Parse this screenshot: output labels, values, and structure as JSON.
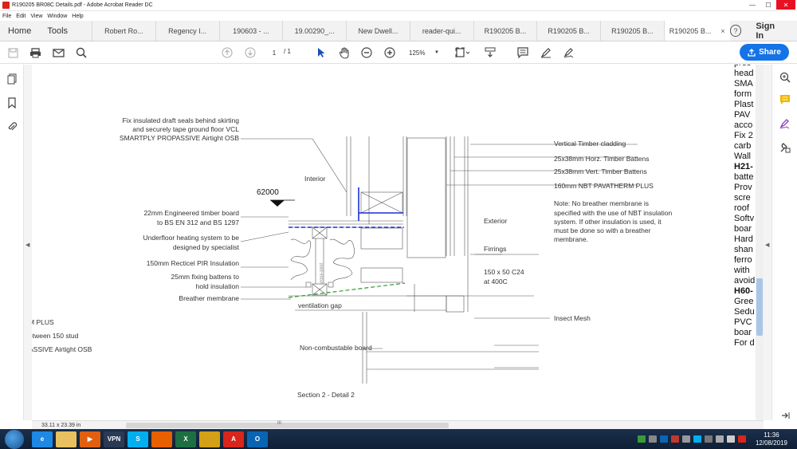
{
  "window": {
    "title": "R190205 BR08C Details.pdf - Adobe Acrobat Reader DC",
    "controls": {
      "minimize": "—",
      "maximize": "☐",
      "close": "✕"
    }
  },
  "menu": [
    "File",
    "Edit",
    "View",
    "Window",
    "Help"
  ],
  "tabs": {
    "home": "Home",
    "tools": "Tools",
    "documents": [
      "Robert Ro...",
      "Regency I...",
      "190603 - ...",
      "19.00290_...",
      "New Dwell...",
      "reader-qui...",
      "R190205 B...",
      "R190205 B...",
      "R190205 B..."
    ],
    "active_document": "R190205 B...",
    "close_glyph": "×"
  },
  "header_right": {
    "help": "?",
    "sign_in": "Sign In"
  },
  "toolbar": {
    "page_current": "1",
    "page_total": "/ 1",
    "zoom": "125%",
    "share_label": "Share"
  },
  "drawing": {
    "labels_left": [
      "Fix insulated draft seals behind skirting",
      "and securely tape ground floor VCL",
      "SMARTPLY PROPASSIVE Airtight OSB",
      "22mm Engineered timber board",
      "to BS EN 312 and BS 1297",
      "Underfloor heating system to be",
      "designed by specialist",
      "150mm Recticel PIR Insulation",
      "25mm fixing battens to",
      "hold insulation",
      "Breather membrane"
    ],
    "labels_right": [
      "Vertical Timber cladding",
      "25x38mm Horz. Timber Battens",
      "25x38mm Vert. Timber Battens",
      "160mm NBT PAVATHERM PLUS"
    ],
    "note": [
      "Note: No breather membrane is",
      "specified with the use of NBT insulation",
      "system. If other insulation is used, it",
      "must be done so with a breather",
      "membrane."
    ],
    "interior": "Interior",
    "exterior": "Exterior",
    "firrings": "Firrings",
    "timber": [
      "150 x 50 C24",
      "at 400C"
    ],
    "level": "62000",
    "ventilation": "ventilation gap",
    "noncombustible": "Non-combustable board",
    "insect_mesh": "Insect Mesh",
    "cross_joist": "cross-joist",
    "section_title": "Section 2 - Detail 2",
    "partial_left": [
      "M PLUS",
      "etween 150 stud",
      "ASSIVE Airtight OSB"
    ]
  },
  "right_text": [
    {
      "t": "pres",
      "b": false
    },
    {
      "t": "head",
      "b": false
    },
    {
      "t": "SMA",
      "b": false
    },
    {
      "t": "form",
      "b": false
    },
    {
      "t": "Plast",
      "b": false
    },
    {
      "t": "PAV",
      "b": false
    },
    {
      "t": "acco",
      "b": false
    },
    {
      "t": "Fix 2",
      "b": false
    },
    {
      "t": "carb",
      "b": false
    },
    {
      "t": "",
      "b": false
    },
    {
      "t": "Wall",
      "b": false
    },
    {
      "t": "",
      "b": false
    },
    {
      "t": "",
      "b": false
    },
    {
      "t": "H21-",
      "b": true
    },
    {
      "t": "batte",
      "b": false
    },
    {
      "t": "",
      "b": false
    },
    {
      "t": "Prov",
      "b": false
    },
    {
      "t": "scre",
      "b": false
    },
    {
      "t": "roof",
      "b": false
    },
    {
      "t": "Softv",
      "b": false
    },
    {
      "t": "boar",
      "b": false
    },
    {
      "t": "Hard",
      "b": false
    },
    {
      "t": "shan",
      "b": false
    },
    {
      "t": "ferro",
      "b": false
    },
    {
      "t": "with",
      "b": false
    },
    {
      "t": "avoid",
      "b": false
    },
    {
      "t": "",
      "b": false
    },
    {
      "t": "H60-",
      "b": true
    },
    {
      "t": "Gree",
      "b": false
    },
    {
      "t": "Sedu",
      "b": false
    },
    {
      "t": "PVC",
      "b": false
    },
    {
      "t": "boar",
      "b": false
    },
    {
      "t": "For d",
      "b": false
    }
  ],
  "status": {
    "dimensions": "33.11 x 23.39 in",
    "scroll_grip": "III"
  },
  "taskbar": {
    "apps": [
      {
        "name": "ie",
        "label": "e",
        "color": "#1e88e5"
      },
      {
        "name": "explorer",
        "label": "",
        "color": "#e8c060"
      },
      {
        "name": "media",
        "label": "▶",
        "color": "#e06010"
      },
      {
        "name": "vpn",
        "label": "VPN",
        "color": "#2a3a55"
      },
      {
        "name": "skype",
        "label": "S",
        "color": "#00aff0"
      },
      {
        "name": "firefox",
        "label": "",
        "color": "#e66000"
      },
      {
        "name": "excel",
        "label": "X",
        "color": "#1d6f42"
      },
      {
        "name": "notes",
        "label": "",
        "color": "#d4a017"
      },
      {
        "name": "acrobat",
        "label": "A",
        "color": "#d9251c"
      },
      {
        "name": "outlook",
        "label": "O",
        "color": "#0a64b4"
      }
    ],
    "time": "11:36",
    "date": "12/08/2019"
  },
  "colors": {
    "accent": "#1473e6",
    "membrane_blue": "#1a2fd8",
    "membrane_green": "#2a9a2a"
  }
}
